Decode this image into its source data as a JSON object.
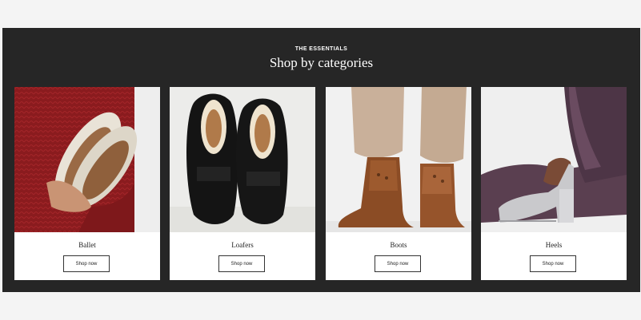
{
  "section": {
    "eyebrow": "THE ESSENTIALS",
    "title": "Shop by categories"
  },
  "cards": [
    {
      "label": "Ballet",
      "button": "Shop now",
      "image": "ballet-flats-photo"
    },
    {
      "label": "Loafers",
      "button": "Shop now",
      "image": "black-loafers-photo"
    },
    {
      "label": "Boots",
      "button": "Shop now",
      "image": "brown-boots-photo"
    },
    {
      "label": "Heels",
      "button": "Shop now",
      "image": "silver-platform-heels-photo"
    }
  ],
  "colors": {
    "page_bg": "#f4f4f4",
    "section_bg": "#262626",
    "card_bg": "#ffffff",
    "text_light": "#ffffff",
    "text_dark": "#222222"
  }
}
